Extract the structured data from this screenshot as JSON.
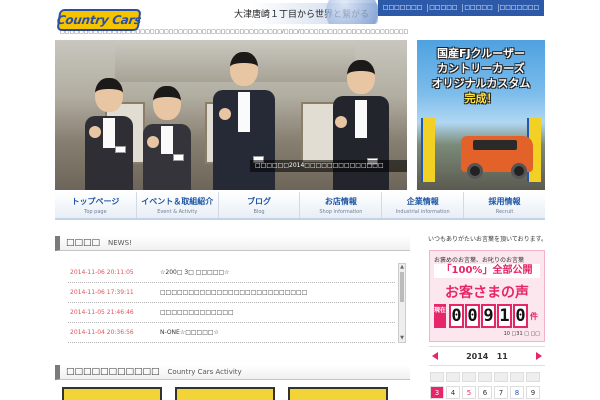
{
  "header": {
    "logo_text": "Country Cars",
    "tagline": "大津唐崎１丁目から世界と繋がる",
    "subtitle": "□□□□□□□□□□□□□□□□□□□□□□□□□□□□□□□□□□□□□□□□□□□□□□□/□□□/□□□□□□□□□□□□□□□□□□□□□□□",
    "top_links": [
      "□□□□□□□",
      "□□□□□",
      "□□□□□",
      "□□□□□□□"
    ],
    "top_nav_color": "#2c5aa8"
  },
  "hero": {
    "caption": "□□□□□□2014□□□□□□□□□□□□□□",
    "promo_lines": [
      "国産FJクルーザー",
      "カントリーカーズ",
      "オリジナルカスタム",
      "完成！"
    ]
  },
  "nav": {
    "items": [
      {
        "jp": "トップページ",
        "en": "Top page"
      },
      {
        "jp": "イベント＆取組紹介",
        "en": "Event & Activity"
      },
      {
        "jp": "ブログ",
        "en": "Blog"
      },
      {
        "jp": "お店情報",
        "en": "Shop information"
      },
      {
        "jp": "企業情報",
        "en": "Industrial information"
      },
      {
        "jp": "採用情報",
        "en": "Recruit"
      }
    ]
  },
  "news": {
    "heading_jp": "□□□□",
    "heading_en": "NEWS!",
    "items": [
      {
        "date": "2014-11-06 20:11:05",
        "title": "☆200□ 3□ □□□□□☆"
      },
      {
        "date": "2014-11-06 17:39:11",
        "title": "□□□□□□□□□□□□□□□□□□□□□□□□□□"
      },
      {
        "date": "2014-11-05 21:46:46",
        "title": "□□□□□□□□□□□□□"
      },
      {
        "date": "2014-11-04 20:36:56",
        "title": "N-ONE☆□□□□□☆"
      }
    ]
  },
  "activity": {
    "heading_jp": "□□□□□□□□□□□",
    "heading_en": "Country Cars Activity"
  },
  "sidebar": {
    "intro": "いつもありがたいお言葉を頂いております。",
    "voice_line1": "お褒めのお言葉、お叱りのお言葉",
    "voice_line2": "「100%」全部公開",
    "voice_line3": "お客さまの声",
    "counter_label": "現在",
    "counter_digits": [
      "0",
      "0",
      "9",
      "1",
      "0"
    ],
    "counter_unit": "件",
    "as_of": "10 □31 □ □□",
    "accent_color": "#e72569"
  },
  "calendar": {
    "year": "2014",
    "month": "11",
    "visible_days": [
      {
        "day": "3",
        "type": "hol"
      },
      {
        "day": "4",
        "type": "normal"
      },
      {
        "day": "5",
        "type": "sat"
      },
      {
        "day": "6",
        "type": "normal"
      },
      {
        "day": "7",
        "type": "normal"
      },
      {
        "day": "8",
        "type": "normal"
      },
      {
        "day": "9",
        "type": "normal"
      }
    ]
  },
  "icons": {
    "prev": "chevron-left-icon",
    "next": "chevron-right-icon"
  }
}
